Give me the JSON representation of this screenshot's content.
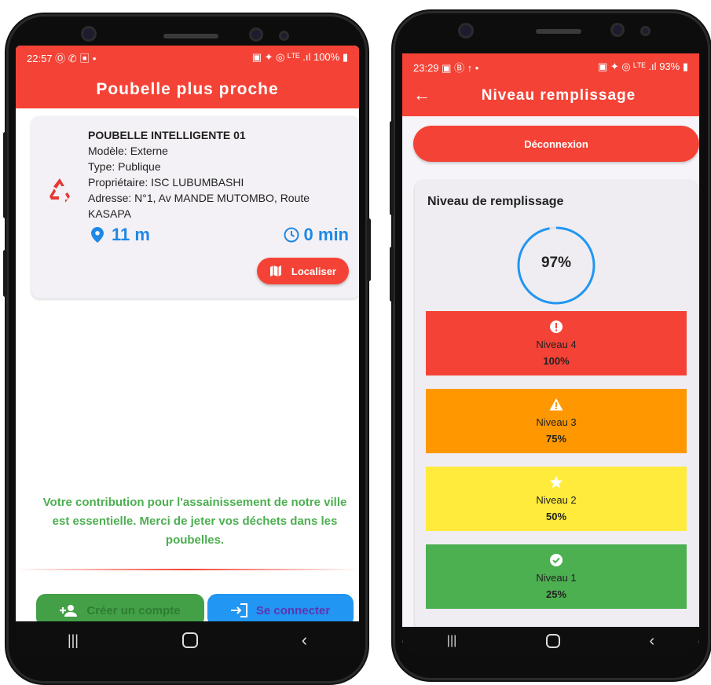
{
  "left": {
    "status": {
      "time": "22:57",
      "left_icons": "Ⓞ ✆ ▣ •",
      "right_icons": "▣ ✦ ◎ ᴸᵀᴱ .ıl",
      "battery": "100%"
    },
    "title": "Poubelle plus proche",
    "bin": {
      "name": "POUBELLE INTELLIGENTE 01",
      "model": "Modèle: Externe",
      "type": "Type: Publique",
      "owner": "Propriétaire: ISC LUBUMBASHI",
      "address": "Adresse: N°1, Av MANDE MUTOMBO, Route KASAPA",
      "distance": "11 m",
      "duration": "0 min",
      "locate_label": "Localiser"
    },
    "message": "Votre contribution pour  l'assainissement de notre ville est essentielle. Merci de jeter vos déchets dans les poubelles.",
    "create_account_label": "Créer un compte",
    "login_label": "Se connecter"
  },
  "right": {
    "status": {
      "time": "23:29",
      "left_icons": "▣ Ⓑ ↑ •",
      "right_icons": "▣ ✦ ◎ ᴸᵀᴱ .ıl",
      "battery": "93%"
    },
    "title": "Niveau remplissage",
    "logout_label": "Déconnexion",
    "section_title": "Niveau de remplissage",
    "fill_percent": "97%",
    "fill_fraction": 0.97,
    "levels": [
      {
        "label": "Niveau 4",
        "percent": "100%",
        "color": "#f44336",
        "icon": "alert-circle-icon"
      },
      {
        "label": "Niveau 3",
        "percent": "75%",
        "color": "#ff9800",
        "icon": "warning-icon"
      },
      {
        "label": "Niveau 2",
        "percent": "50%",
        "color": "#ffeb3b",
        "icon": "star-icon"
      },
      {
        "label": "Niveau 1",
        "percent": "25%",
        "color": "#4caf50",
        "icon": "check-circle-icon"
      }
    ]
  },
  "colors": {
    "red": "#f44336",
    "blue": "#2196f3",
    "green": "#43a047",
    "message_green": "#4caf50"
  }
}
